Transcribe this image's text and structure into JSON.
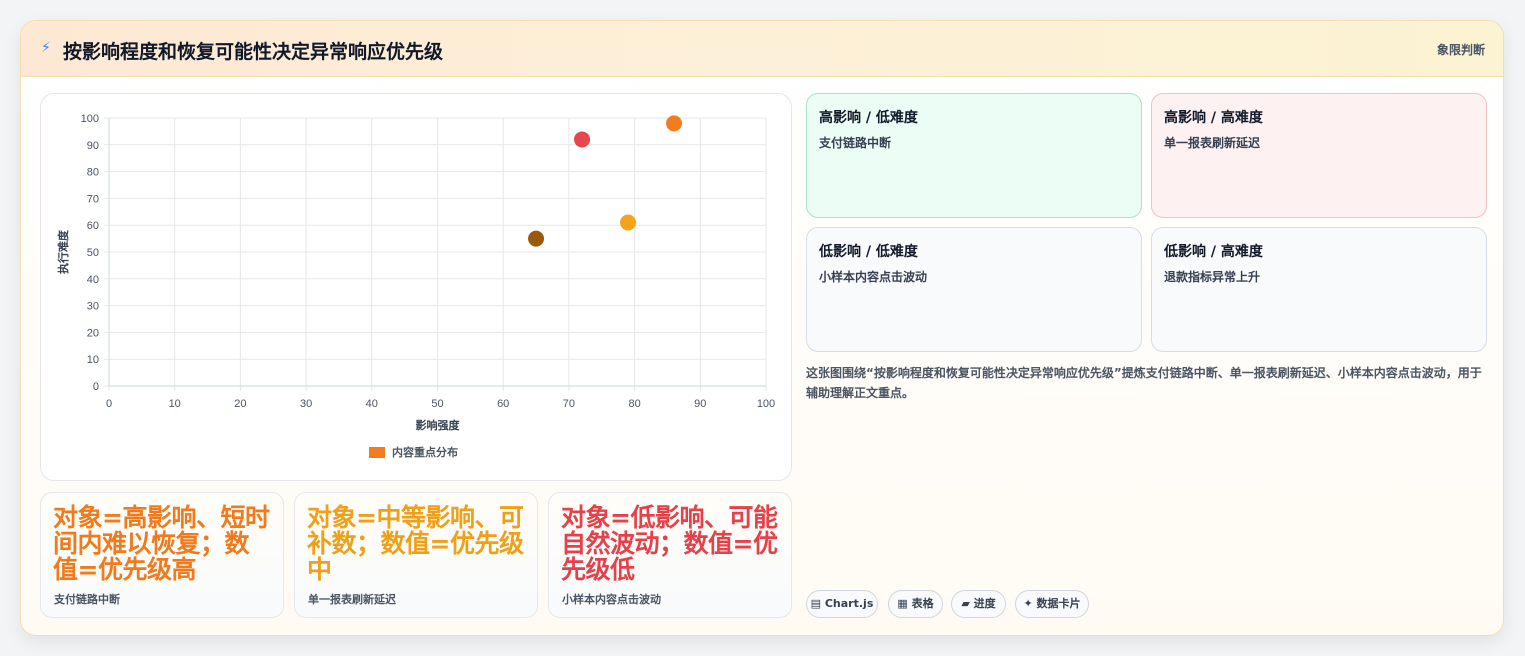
{
  "header": {
    "icon": "lightning-icon",
    "title": "按影响程度和恢复可能性决定异常响应优先级",
    "tag": "象限判断"
  },
  "chart_data": {
    "type": "scatter",
    "xlabel": "影响强度",
    "ylabel": "执行难度",
    "xlim": [
      0,
      100
    ],
    "ylim": [
      0,
      100
    ],
    "x_ticks": [
      "0",
      "10",
      "20",
      "30",
      "40",
      "50",
      "60",
      "70",
      "80",
      "90",
      "100"
    ],
    "y_ticks": [
      "0",
      "10",
      "20",
      "30",
      "40",
      "50",
      "60",
      "70",
      "80",
      "90",
      "100"
    ],
    "grid": true,
    "legend_position": "bottom",
    "series": [
      {
        "name": "内容重点分布",
        "legend_color": "#f47c20",
        "points": [
          {
            "x": 72,
            "y": 92,
            "color": "#e5474b"
          },
          {
            "x": 86,
            "y": 98,
            "color": "#f47c20"
          },
          {
            "x": 79,
            "y": 61,
            "color": "#f3a31c"
          },
          {
            "x": 65,
            "y": 55,
            "color": "#9a5a0a"
          }
        ]
      }
    ]
  },
  "stats": [
    {
      "main": "对象=高影响、短时间内难以恢复；数值=优先级高",
      "sub": "支付链路中断",
      "color": "#f07a1c"
    },
    {
      "main": "对象=中等影响、可补数；数值=优先级中",
      "sub": "单一报表刷新延迟",
      "color": "#f0a018"
    },
    {
      "main": "对象=低影响、可能自然波动；数值=优先级低",
      "sub": "小样本内容点击波动",
      "color": "#e5414a"
    }
  ],
  "quadrants": [
    {
      "title": "高影响 / 低难度",
      "body": "支付链路中断",
      "bg": "#ecfdf5",
      "border": "#a7e4c9"
    },
    {
      "title": "高影响 / 高难度",
      "body": "单一报表刷新延迟",
      "bg": "#fef1f1",
      "border": "#f2c2c5"
    },
    {
      "title": "低影响 / 低难度",
      "body": "小样本内容点击波动",
      "bg": "#f8fafc",
      "border": "#d7dde5"
    },
    {
      "title": "低影响 / 高难度",
      "body": "退款指标异常上升",
      "bg": "#f8fafc",
      "border": "#d7dde5"
    }
  ],
  "note": "这张图围绕“按影响程度和恢复可能性决定异常响应优先级”提炼支付链路中断、单一报表刷新延迟、小样本内容点击波动，用于辅助理解正文重点。",
  "tags": [
    {
      "icon": "chart-icon",
      "label": "Chart.js",
      "glyph": "▤"
    },
    {
      "icon": "table-icon",
      "label": "表格",
      "glyph": "▦"
    },
    {
      "icon": "progress-icon",
      "label": "进度",
      "glyph": "▰"
    },
    {
      "icon": "sparkle-icon",
      "label": "数据卡片",
      "glyph": "✦"
    }
  ]
}
